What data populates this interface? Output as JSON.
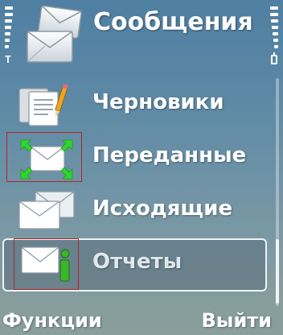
{
  "header": {
    "title": "Сообщения",
    "icon": "messaging-envelopes-icon"
  },
  "status": {
    "signal_icon": "signal-strength-icon",
    "battery_icon": "battery-icon"
  },
  "menu": {
    "items": [
      {
        "label": "Черновики",
        "icon": "drafts-icon"
      },
      {
        "label": "Переданные",
        "icon": "sent-icon"
      },
      {
        "label": "Исходящие",
        "icon": "outbox-icon"
      },
      {
        "label": "Отчеты",
        "icon": "reports-icon",
        "selected": true
      }
    ]
  },
  "softkeys": {
    "left": "Функции",
    "right": "Выйти"
  },
  "colors": {
    "highlight_border": "#b0262a",
    "arrow_green": "#2ed62e",
    "info_green": "#3bb52b"
  }
}
